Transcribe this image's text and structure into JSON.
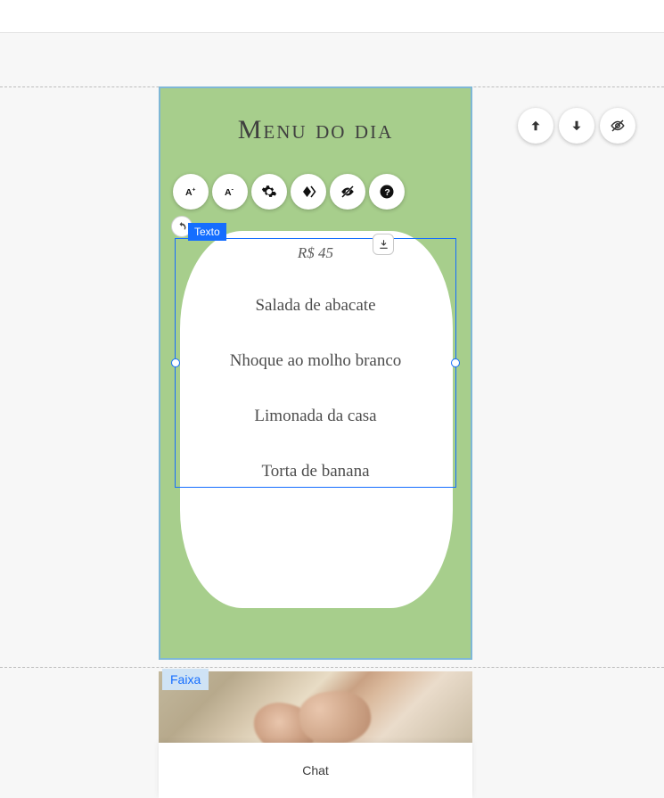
{
  "header": {
    "title": "Menu do dia"
  },
  "selection": {
    "label": "Texto"
  },
  "menu_card": {
    "price": "R$ 45",
    "items": [
      "Salada de abacate",
      "Nhoque ao molho branco",
      "Limonada da casa",
      "Torta de banana"
    ]
  },
  "strip": {
    "label": "Faixa"
  },
  "chat": {
    "label": "Chat"
  },
  "toolbar_icons": {
    "font_increase": "A+",
    "font_decrease": "A-",
    "settings": "gear",
    "animations": "diamond",
    "visibility": "eye-off",
    "help": "?"
  },
  "right_controls": {
    "up": "arrow-up",
    "down": "arrow-down",
    "hide": "eye-off"
  }
}
